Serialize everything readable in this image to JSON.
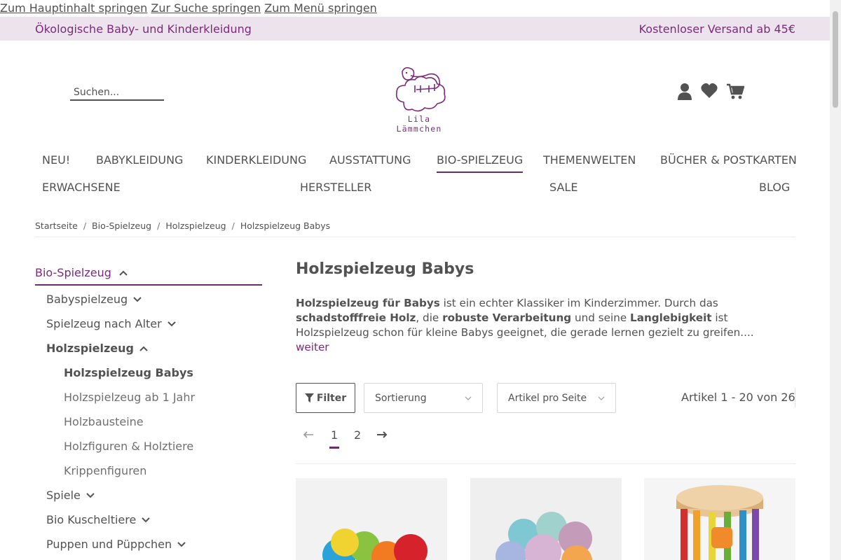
{
  "skip_links": [
    "Zum Hauptinhalt springen",
    "Zur Suche springen",
    "Zum Menü springen"
  ],
  "topbar": {
    "left": "Ökologische Baby- und Kinderkleidung",
    "right": "Kostenloser Versand ab 45€"
  },
  "search": {
    "placeholder": "Suchen..."
  },
  "logo": {
    "text": "Lila Lämmchen"
  },
  "nav": {
    "row1": [
      "NEU!",
      "BABYKLEIDUNG",
      "KINDERKLEIDUNG",
      "AUSSTATTUNG",
      "BIO-SPIELZEUG",
      "THEMENWELTEN",
      "BÜCHER & POSTKARTEN"
    ],
    "row2": [
      "ERWACHSENE",
      "HERSTELLER",
      "SALE",
      "BLOG"
    ],
    "active": "BIO-SPIELZEUG"
  },
  "breadcrumb": [
    "Startseite",
    "Bio-Spielzeug",
    "Holzspielzeug",
    "Holzspielzeug Babys"
  ],
  "sidebar": {
    "title": "Bio-Spielzeug",
    "items": [
      {
        "label": "Babyspielzeug"
      },
      {
        "label": "Spielzeug nach Alter"
      },
      {
        "label": "Holzspielzeug"
      },
      {
        "label": "Holzspielzeug Babys"
      },
      {
        "label": "Holzspielzeug ab 1 Jahr"
      },
      {
        "label": "Holzbausteine"
      },
      {
        "label": "Holzfiguren & Holztiere"
      },
      {
        "label": "Krippenfiguren"
      },
      {
        "label": "Spiele"
      },
      {
        "label": "Bio Kuscheltiere"
      },
      {
        "label": "Puppen und Püppchen"
      }
    ]
  },
  "main": {
    "title": "Holzspielzeug Babys",
    "desc": {
      "b1": "Holzspielzeug für Babys",
      "t1": " ist ein echter Klassiker im Kinderzimmer. Durch das ",
      "b2": "schadstofffreie Holz",
      "t2": ", die ",
      "b3": "robuste Verarbeitung",
      "t3": " und seine ",
      "b4": "Langlebigkeit",
      "t4": " ist Holzspielzeug schon für kleine Babys geeignet, die gerade lernen gezielt zu greifen.... ",
      "more": "weiter"
    },
    "filter_label": "Filter",
    "sort_label": "Sortierung",
    "per_page_label": "Artikel pro Seite",
    "count": "Artikel 1 - 20 von 26",
    "pages": [
      "1",
      "2"
    ],
    "active_page": "1"
  },
  "colors": {
    "accent": "#6c2b6c",
    "topbar_bg": "#ece3ec",
    "text": "#525252"
  }
}
